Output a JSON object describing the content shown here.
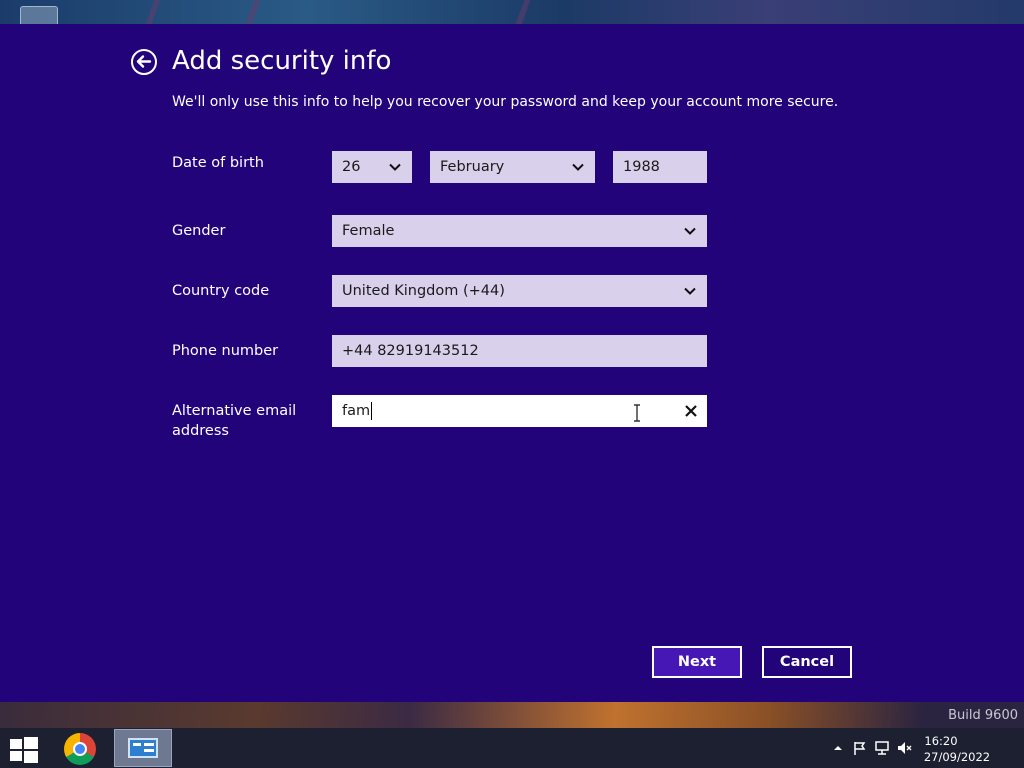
{
  "dialog": {
    "title": "Add security info",
    "subtitle": "We'll only use this info to help you recover your password and keep your account more secure."
  },
  "form": {
    "dob_label": "Date of birth",
    "dob_day": "26",
    "dob_month": "February",
    "dob_year": "1988",
    "gender_label": "Gender",
    "gender_value": "Female",
    "country_label": "Country code",
    "country_value": "United Kingdom (+44)",
    "phone_label": "Phone number",
    "phone_value": "+44 82919143512",
    "alt_email_label": "Alternative email address",
    "alt_email_value": "fam"
  },
  "buttons": {
    "next": "Next",
    "cancel": "Cancel"
  },
  "desktop": {
    "build": "Build 9600"
  },
  "taskbar": {
    "time": "16:20",
    "date": "27/09/2022"
  },
  "icons": [
    "back-arrow-icon",
    "chevron-down-icon",
    "clear-x-icon",
    "text-cursor-icon",
    "windows-start-icon",
    "chrome-icon",
    "control-panel-icon",
    "tray-up-arrow-icon",
    "flag-icon",
    "network-icon",
    "volume-muted-icon"
  ],
  "colors": {
    "dialog_background": "#22037a",
    "field_background": "#d9d1ec",
    "next_button": "#4617b4"
  }
}
